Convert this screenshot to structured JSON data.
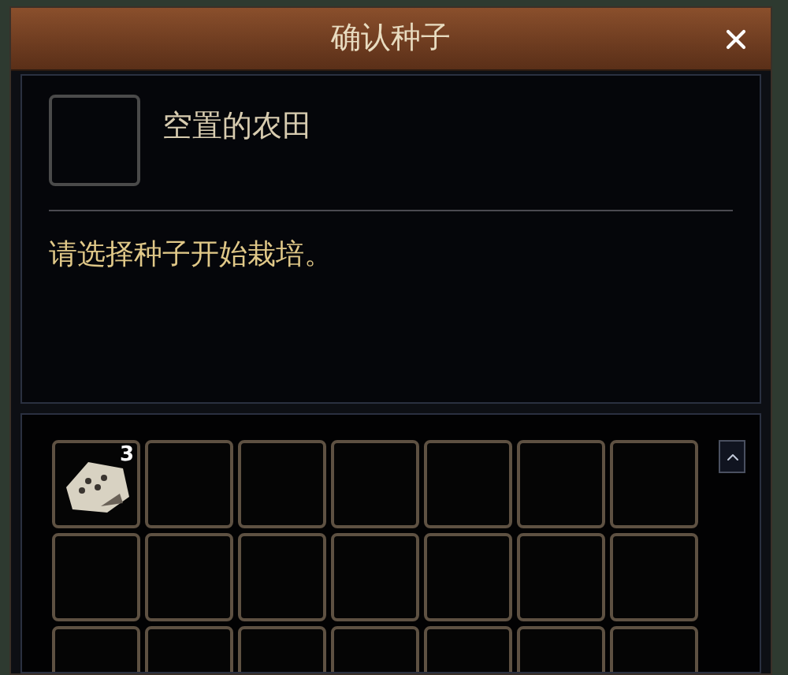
{
  "window": {
    "title": "确认种子"
  },
  "farm": {
    "label": "空置的农田"
  },
  "message": "请选择种子开始栽培。",
  "slots": [
    {
      "kind": "item",
      "count": "3"
    },
    {
      "kind": "empty"
    },
    {
      "kind": "empty"
    },
    {
      "kind": "empty"
    },
    {
      "kind": "empty"
    },
    {
      "kind": "empty"
    },
    {
      "kind": "empty"
    },
    {
      "kind": "empty"
    },
    {
      "kind": "empty"
    },
    {
      "kind": "empty"
    },
    {
      "kind": "empty"
    },
    {
      "kind": "empty"
    },
    {
      "kind": "empty"
    },
    {
      "kind": "empty"
    },
    {
      "kind": "empty"
    },
    {
      "kind": "empty"
    },
    {
      "kind": "empty"
    },
    {
      "kind": "empty"
    },
    {
      "kind": "empty"
    },
    {
      "kind": "empty"
    },
    {
      "kind": "empty"
    }
  ]
}
